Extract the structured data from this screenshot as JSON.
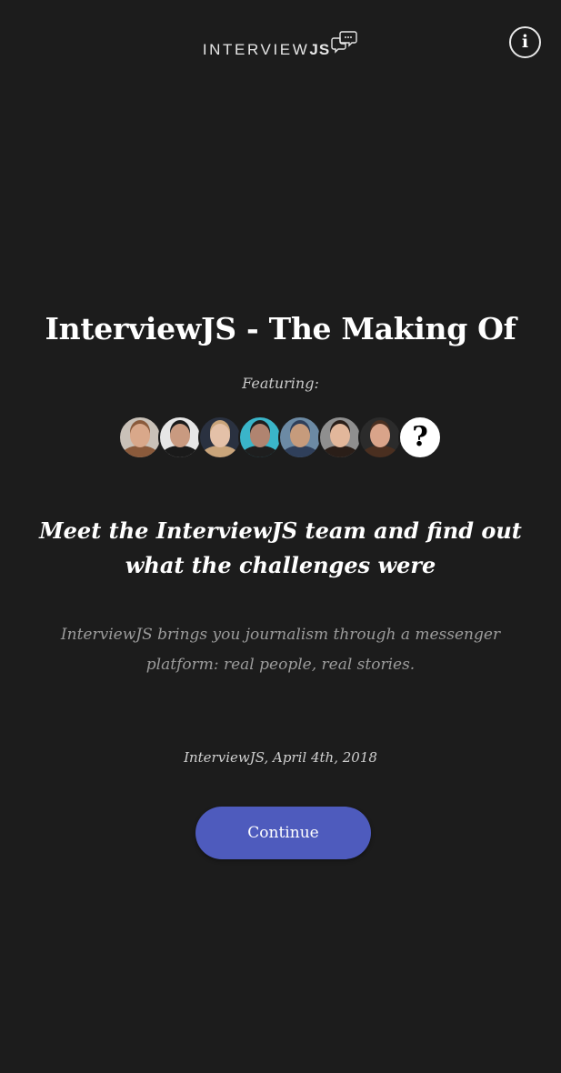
{
  "header": {
    "logo_text": "INTERVIEW",
    "logo_js": "JS",
    "info_label": "i"
  },
  "intro": {
    "title": "InterviewJS - The Making Of",
    "featuring_label": "Featuring:",
    "avatars": [
      {
        "name": "avatar-1",
        "skin": "#d9a88a",
        "hair": "#8a5a3b",
        "bg": "#c9c1b8"
      },
      {
        "name": "avatar-2",
        "skin": "#c99a80",
        "hair": "#1a1a1a",
        "bg": "#e6e6e6"
      },
      {
        "name": "avatar-3",
        "skin": "#e4c1a8",
        "hair": "#c9a47a",
        "bg": "#2a3140"
      },
      {
        "name": "avatar-4",
        "skin": "#b08470",
        "hair": "#1e1e1e",
        "bg": "#3ab5c9"
      },
      {
        "name": "avatar-5",
        "skin": "#c69b7c",
        "hair": "#2f3f5a",
        "bg": "#6c8aa4"
      },
      {
        "name": "avatar-6",
        "skin": "#e2b79b",
        "hair": "#2a1e18",
        "bg": "#8f8f8f"
      },
      {
        "name": "avatar-7",
        "skin": "#d9a48a",
        "hair": "#4a2f20",
        "bg": "#2b2b2b"
      }
    ],
    "unknown_avatar_label": "?",
    "subtitle": "Meet the InterviewJS team and find out what the challenges were",
    "description": "InterviewJS brings you journalism through a messenger platform: real people, real stories.",
    "byline": "InterviewJS, April 4th, 2018",
    "continue_label": "Continue"
  },
  "colors": {
    "background": "#1c1c1c",
    "button": "#4e5bbd"
  }
}
